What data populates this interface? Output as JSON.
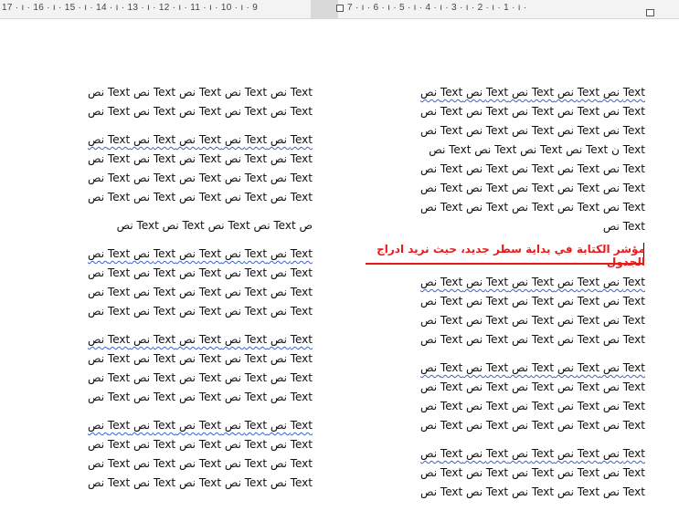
{
  "ruler": {
    "left_numbers": "17 · ı · 16 · ı · 15 · ı · 14 · ı · 13 · ı · 12 · ı · 11 · ı · 10 · ı · 9",
    "right_numbers": "7 · ı · 6 · ı · 5 · ı · 4 · ı · 3 · ı · 2 · ı · 1 · ı ·"
  },
  "accent_colors": {
    "note_red": "#e51c1c",
    "spell_underline": "#3a63c9"
  },
  "right_column": {
    "block1": [
      "Text نص Text نص Text نص Text نص Text نص",
      "Text نص Text نص Text نص Text نص Text نص",
      "Text نص Text نص Text نص Text نص Text نص",
      "Text ن Text نص Text نص Text نص Text نص",
      "Text نص Text نص Text نص Text نص Text نص",
      "Text نص Text نص Text نص Text نص Text نص",
      "Text نص Text نص Text نص Text نص Text نص",
      "Text نص"
    ],
    "note": "مؤشر الكتابة في بداية سطر جديد، حيث نريد ادراج الجدول",
    "block2": [
      "Text نص Text نص Text نص Text نص Text نص",
      "Text نص Text نص Text نص Text نص Text نص",
      "Text نص Text نص Text نص Text نص Text نص",
      "Text نص Text نص Text نص Text نص Text نص"
    ],
    "block3": [
      "Text نص Text نص Text نص Text نص Text نص",
      "Text نص Text نص Text نص Text نص Text نص",
      "Text نص Text نص Text نص Text نص Text نص",
      "Text نص Text نص Text نص Text نص Text نص"
    ],
    "block4": [
      "Text نص Text نص Text نص Text نص Text نص",
      "Text نص Text نص Text نص Text نص Text نص",
      "Text نص Text نص Text نص Text نص Text نص"
    ]
  },
  "left_column": {
    "block1": [
      "Text نص Text نص Text نص Text نص Text نص",
      "Text نص Text نص Text نص Text نص Text نص"
    ],
    "block2": [
      "Text نص Text نص Text نص Text نص Text نص",
      "Text نص Text نص Text نص Text نص Text نص",
      "Text نص Text نص Text نص Text نص Text نص",
      "Text نص Text نص Text نص Text نص Text نص"
    ],
    "single": "ص Text نص Text نص Text نص Text نص",
    "block3": [
      "Text نص Text نص Text نص Text نص Text نص",
      "Text نص Text نص Text نص Text نص Text نص",
      "Text نص Text نص Text نص Text نص Text نص",
      "Text نص Text نص Text نص Text نص Text نص"
    ],
    "block4": [
      "Text نص Text نص Text نص Text نص Text نص",
      "Text نص Text نص Text نص Text نص Text نص",
      "Text نص Text نص Text نص Text نص Text نص",
      "Text نص Text نص Text نص Text نص Text نص"
    ],
    "block5": [
      "Text نص Text نص Text نص Text نص Text نص",
      "Text نص Text نص Text نص Text نص Text نص",
      "Text نص Text نص Text نص Text نص Text نص",
      "Text نص Text نص Text نص Text نص Text نص"
    ]
  }
}
